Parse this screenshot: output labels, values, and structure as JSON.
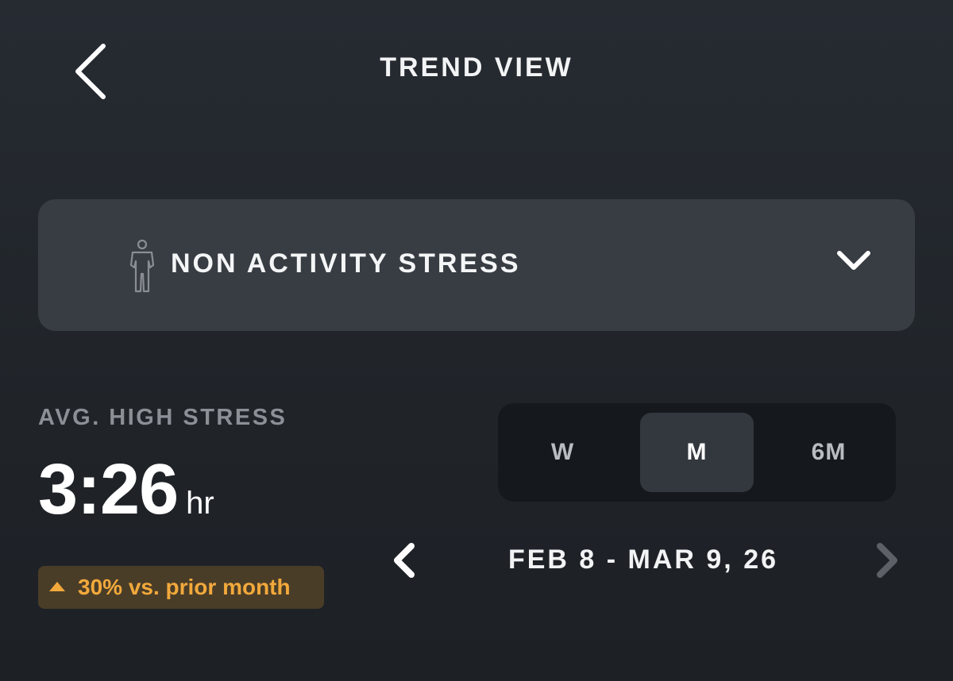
{
  "header": {
    "title": "TREND VIEW",
    "back_icon": "chevron-left-icon"
  },
  "metric_selector": {
    "icon": "person-icon",
    "label": "NON ACTIVITY STRESS",
    "dropdown_icon": "chevron-down-icon"
  },
  "summary": {
    "label": "AVG. HIGH STRESS",
    "value": "3:26",
    "unit": "hr",
    "change": {
      "direction": "up",
      "text": "30% vs. prior month",
      "color": "#f2a93b"
    }
  },
  "period_toggle": {
    "options": [
      "W",
      "M",
      "6M"
    ],
    "selected": "M"
  },
  "date_range": {
    "label": "FEB 8 - MAR 9, 26",
    "prev_icon": "chevron-left-icon",
    "next_icon": "chevron-right-icon",
    "next_enabled": false
  },
  "colors": {
    "background": "#22262b",
    "card": "#383d43",
    "accent_warning": "#f2a93b",
    "muted_text": "#8c9096"
  }
}
